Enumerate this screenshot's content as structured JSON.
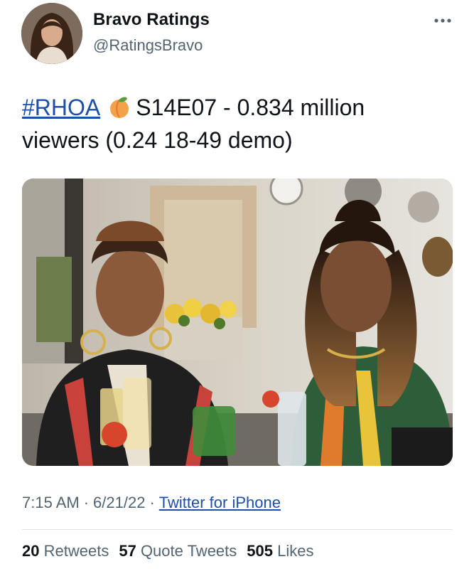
{
  "author": {
    "display_name": "Bravo Ratings",
    "handle": "@RatingsBravo"
  },
  "tweet": {
    "hashtag": "#RHOA",
    "emoji": "peach-icon",
    "text_line1": "S14E07 - 0.834 million",
    "text_line2": "viewers (0.24 18-49 demo)"
  },
  "meta": {
    "time": "7:15 AM",
    "date": "6/21/22",
    "separator": "·",
    "source": "Twitter for iPhone"
  },
  "stats": {
    "retweets_count": "20",
    "retweets_label": "Retweets",
    "quotes_count": "57",
    "quotes_label": "Quote Tweets",
    "likes_count": "505",
    "likes_label": "Likes"
  },
  "colors": {
    "link": "#1d4fa8",
    "secondary_text": "#536471",
    "primary_text": "#0f1419"
  }
}
